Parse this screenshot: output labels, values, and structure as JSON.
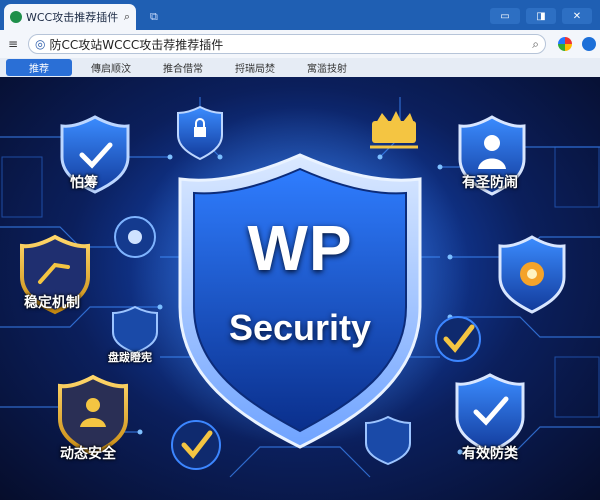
{
  "browser": {
    "tab_title": "WCC攻击推荐插件",
    "address_text": "防CC攻站WCCC攻击荐推荐插件",
    "nav_tabs": [
      "推荐",
      "傳启顺汶",
      "推合借常",
      "捋瑞局焚",
      "寓滥技射"
    ]
  },
  "hero": {
    "main_title": "WP",
    "main_subtitle": "Security",
    "labels": {
      "top_left": "怕筹",
      "top_right": "有圣防闹",
      "mid_left": "稳定机制",
      "center_left_small": "盘跋瞪宪",
      "bottom_left": "动态安全",
      "bottom_right": "有效防类"
    }
  },
  "icons": {
    "tab_favicon": "globe-icon",
    "tab_search": "search-icon",
    "address": "search-icon",
    "address_search": "search-icon"
  }
}
